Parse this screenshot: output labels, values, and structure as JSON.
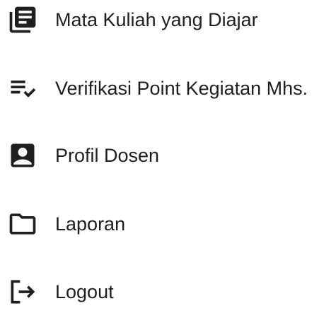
{
  "menu": {
    "items": [
      {
        "label": "Mata Kuliah yang Diajar",
        "icon": "library-books-icon"
      },
      {
        "label": "Verifikasi Point Kegiatan Mhs.",
        "icon": "playlist-check-icon"
      },
      {
        "label": "Profil Dosen",
        "icon": "account-box-icon"
      },
      {
        "label": "Laporan",
        "icon": "folder-icon"
      },
      {
        "label": "Logout",
        "icon": "logout-icon"
      }
    ]
  },
  "colors": {
    "icon": "#1f1f1f",
    "text": "#1f1f1f",
    "background": "#ffffff"
  }
}
